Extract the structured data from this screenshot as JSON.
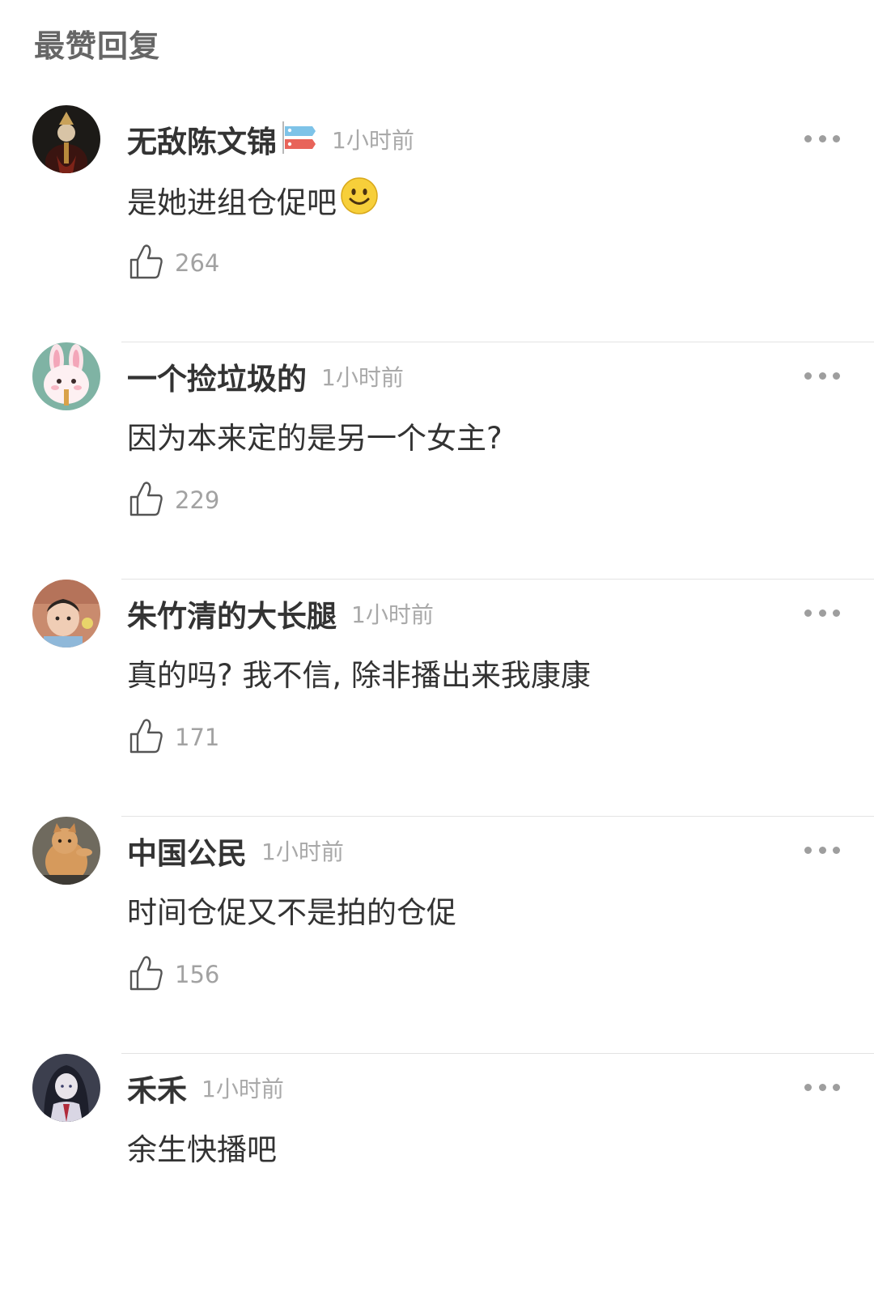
{
  "section": {
    "title": "最赞回复"
  },
  "comments": [
    {
      "username": "无敌陈文锦",
      "time": "1小时前",
      "text": "是她进组仓促吧",
      "likes": "264",
      "has_badge": true,
      "emoji": "smile-emoji"
    },
    {
      "username": "一个捡垃圾的",
      "time": "1小时前",
      "text": "因为本来定的是另一个女主?",
      "likes": "229"
    },
    {
      "username": "朱竹清的大长腿",
      "time": "1小时前",
      "text": "真的吗? 我不信, 除非播出来我康康",
      "likes": "171"
    },
    {
      "username": "中国公民",
      "time": "1小时前",
      "text": "时间仓促又不是拍的仓促",
      "likes": "156"
    },
    {
      "username": "禾禾",
      "time": "1小时前",
      "text": "余生快播吧",
      "likes": ""
    }
  ],
  "icons": {
    "like": "thumbs-up-icon",
    "more": "more-dots-icon"
  },
  "colors": {
    "text": "#333333",
    "muted": "#a9a9a9",
    "divider": "#e3e3e3"
  }
}
